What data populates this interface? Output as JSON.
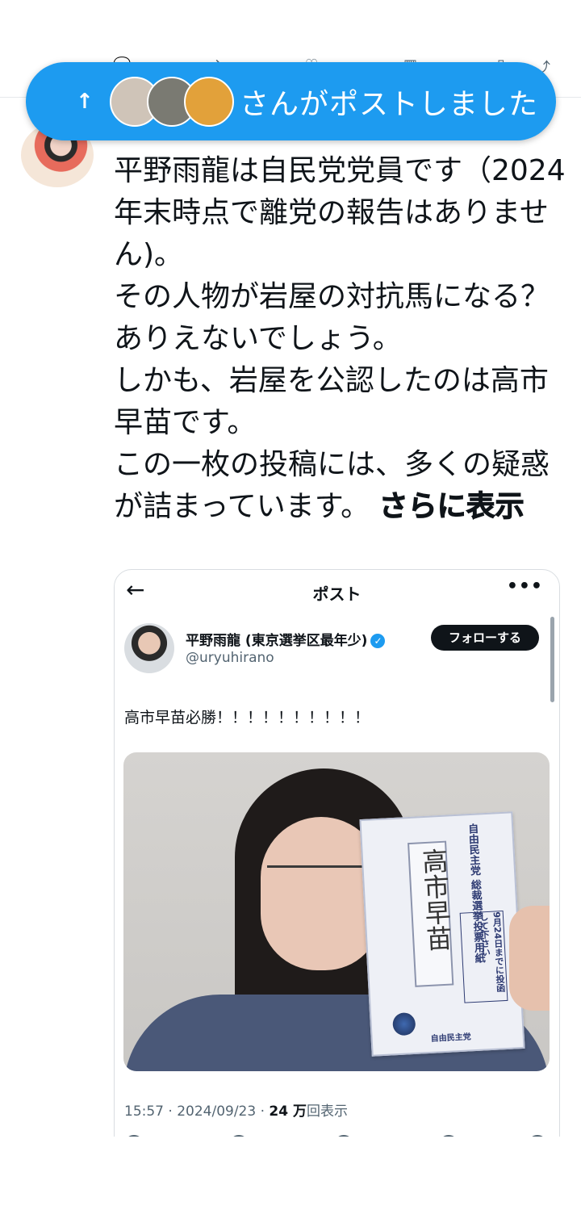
{
  "notification": {
    "label": "さんがポストしました",
    "arrow": "↑",
    "avatar_colors": [
      "#cfc4b8",
      "#7a7a72",
      "#e2a13a"
    ]
  },
  "post": {
    "paragraphs": [
      "平野雨龍は自民党党員です（2024年末時点で離党の報告はありません)。",
      "その人物が岩屋の対抗馬になる？ありえないでしょう。",
      "しかも、岩屋を公認したのは高市早苗です。",
      "この一枚の投稿には、多くの疑惑が詰まっています。 "
    ],
    "show_more": "さらに表示"
  },
  "quoted": {
    "header_title": "ポスト",
    "back_icon": "←",
    "more_icon": "•••",
    "name": "平野雨龍 (東京選挙区最年少)",
    "handle": "@uryuhirano",
    "follow_label": "フォローする",
    "verified_glyph": "✓",
    "text": "高市早苗必勝！！！！！！！！！！",
    "meta_time": "15:57 · 2024/09/23 · ",
    "meta_views_num": "24 万",
    "meta_views_label": "回表示",
    "ballot": {
      "handwritten": "高市早苗",
      "party_title": "自由民主党 総裁選挙投票用紙",
      "deadline": "9月24日までに投函して下さい",
      "footer": "自由民主党"
    }
  }
}
